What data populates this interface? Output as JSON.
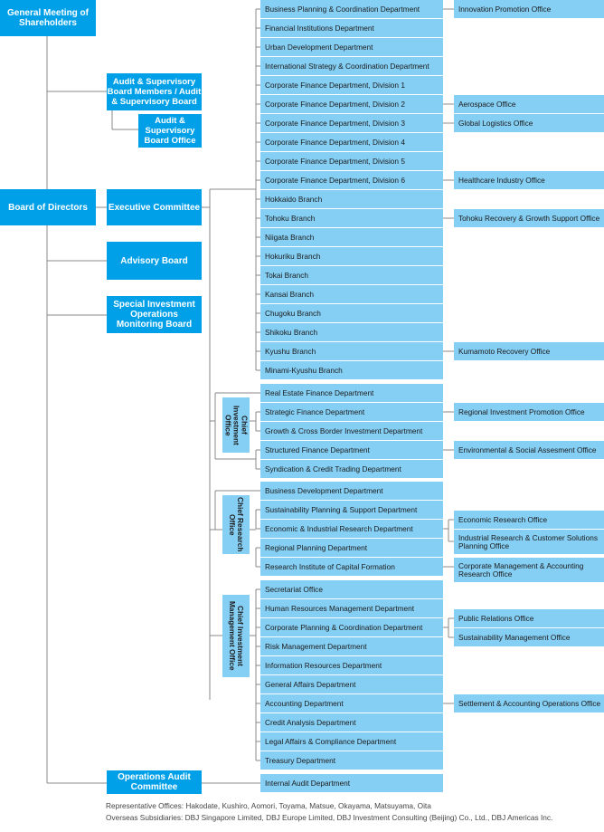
{
  "left": {
    "general_meeting": "General Meeting of Shareholders",
    "audit_board": "Audit & Supervisory Board Members / Audit & Supervisory Board",
    "audit_board_office": "Audit & Supervisory Board Office",
    "board_of_directors": "Board of Directors",
    "executive_committee": "Executive Committee",
    "advisory_board": "Advisory Board",
    "special_investment": "Special Investment Operations Monitoring Board",
    "operations_audit": "Operations Audit Committee"
  },
  "officers": {
    "cio": "Chief Investment Office",
    "cro": "Chief Research Office",
    "cimo": "Chief Investment Management Office"
  },
  "departments": [
    "Business Planning & Coordination Department",
    "Financial Institutions Department",
    "Urban Development Department",
    "International Strategy & Coordination Department",
    "Corporate Finance Department, Division 1",
    "Corporate Finance Department, Division 2",
    "Corporate Finance Department, Division 3",
    "Corporate Finance Department, Division 4",
    "Corporate Finance Department, Division 5",
    "Corporate Finance Department, Division 6",
    "Hokkaido Branch",
    "Tohoku Branch",
    "Niigata Branch",
    "Hokuriku Branch",
    "Tokai Branch",
    "Kansai Branch",
    "Chugoku Branch",
    "Shikoku Branch",
    "Kyushu Branch",
    "Minami-Kyushu Branch",
    "Real Estate Finance Department",
    "Strategic Finance Department",
    "Growth & Cross Border Investment Department",
    "Structured Finance Department",
    "Syndication & Credit Trading Department",
    "Business Development Department",
    "Sustainability Planning & Support Department",
    "Economic & Industrial Research Department",
    "Regional Planning Department",
    "Research Institute of Capital Formation",
    "Secretariat Office",
    "Human Resources Management Department",
    "Corporate Planning & Coordination Department",
    "Risk Management Department",
    "Information Resources Department",
    "General Affairs Department",
    "Accounting Department",
    "Credit Analysis Department",
    "Legal Affairs & Compliance Department",
    "Treasury Department",
    "Internal Audit Department"
  ],
  "offices": [
    "Innovation Promotion Office",
    "Aerospace Office",
    "Global Logistics Office",
    "Healthcare Industry Office",
    "Tohoku Recovery & Growth Support Office",
    "Kumamoto Recovery Office",
    "Regional Investment Promotion Office",
    "Environmental & Social Assesment Office",
    "Economic Research Office",
    "Industrial Research & Customer Solutions Planning Office",
    "Corporate Management & Accounting Research Office",
    "Public Relations Office",
    "Sustainability Management Office",
    "Settlement & Accounting Operations Office"
  ],
  "footer": {
    "representative_offices": "Representative Offices: Hakodate, Kushiro, Aomori, Toyama, Matsue, Okayama, Matsuyama, Oita",
    "overseas_subsidiaries": "Overseas Subsidiaries: DBJ Singapore Limited, DBJ Europe Limited, DBJ Investment Consulting (Beijing) Co., Ltd., DBJ Americas Inc."
  },
  "colors": {
    "primary": "#00a0e9",
    "secondary": "#86cff4",
    "line": "#888888"
  }
}
